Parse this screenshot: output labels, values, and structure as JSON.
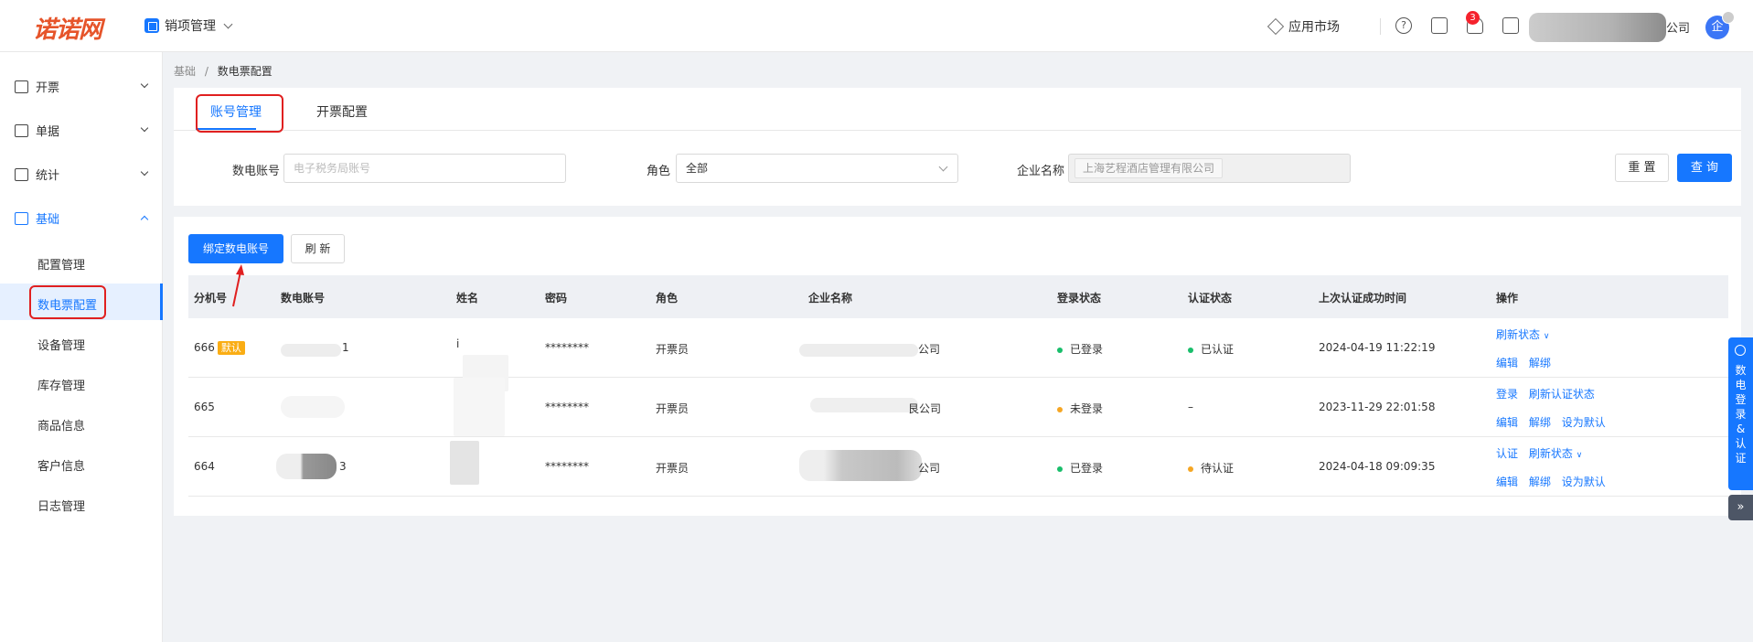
{
  "header": {
    "logo": "诺诺网",
    "module": "销项管理",
    "app_market": "应用市场",
    "help_icon": "?",
    "notification_count": "3",
    "company_tail": "公司",
    "avatar": "企"
  },
  "sidebar": {
    "groups": [
      {
        "label": "开票",
        "icon": "invoice-icon"
      },
      {
        "label": "单据",
        "icon": "document-icon"
      },
      {
        "label": "统计",
        "icon": "chart-icon"
      },
      {
        "label": "基础",
        "icon": "base-icon"
      }
    ],
    "sub_items": [
      "配置管理",
      "数电票配置",
      "设备管理",
      "库存管理",
      "商品信息",
      "客户信息",
      "日志管理"
    ]
  },
  "breadcrumb": {
    "parent": "基础",
    "separator": "/",
    "current": "数电票配置"
  },
  "tabs": [
    "账号管理",
    "开票配置"
  ],
  "filters": {
    "account_label": "数电账号",
    "account_placeholder": "电子税务局账号",
    "role_label": "角色",
    "role_value": "全部",
    "company_label": "企业名称",
    "company_value": "上海艺程酒店管理有限公司",
    "reset": "重 置",
    "query": "查 询"
  },
  "toolbar": {
    "bind": "绑定数电账号",
    "refresh": "刷 新"
  },
  "table": {
    "columns": [
      "分机号",
      "数电账号",
      "姓名",
      "密码",
      "角色",
      "企业名称",
      "登录状态",
      "认证状态",
      "上次认证成功时间",
      "操作"
    ],
    "default_tag": "默认",
    "rows": [
      {
        "ext": "666",
        "account": "1",
        "name": "i",
        "password": "********",
        "role": "开票员",
        "company": "公司",
        "login": "已登录",
        "login_color": "#19be6b",
        "auth": "已认证",
        "auth_color": "#19be6b",
        "time": "2024-04-19 11:22:19",
        "ops_line1": [
          "刷新状态"
        ],
        "ops_line2": [
          "编辑",
          "解绑"
        ]
      },
      {
        "ext": "665",
        "account": "",
        "name": "",
        "password": "********",
        "role": "开票员",
        "company": "艮公司",
        "login": "未登录",
        "login_color": "#f5a623",
        "auth": "–",
        "auth_color": "",
        "time": "2023-11-29 22:01:58",
        "ops_line1": [
          "登录",
          "刷新认证状态"
        ],
        "ops_line2": [
          "编辑",
          "解绑",
          "设为默认"
        ]
      },
      {
        "ext": "664",
        "account": "3",
        "name": "",
        "password": "********",
        "role": "开票员",
        "company": "公司",
        "login": "已登录",
        "login_color": "#19be6b",
        "auth": "待认证",
        "auth_color": "#f5a623",
        "time": "2024-04-18 09:09:35",
        "ops_line1": [
          "认证",
          "刷新状态"
        ],
        "ops_line2": [
          "编辑",
          "解绑",
          "设为默认"
        ]
      }
    ]
  },
  "float_panel": {
    "label": "数电登录&认证",
    "expand": "»"
  },
  "colors": {
    "primary": "#1677ff",
    "highlight": "#e02020"
  }
}
